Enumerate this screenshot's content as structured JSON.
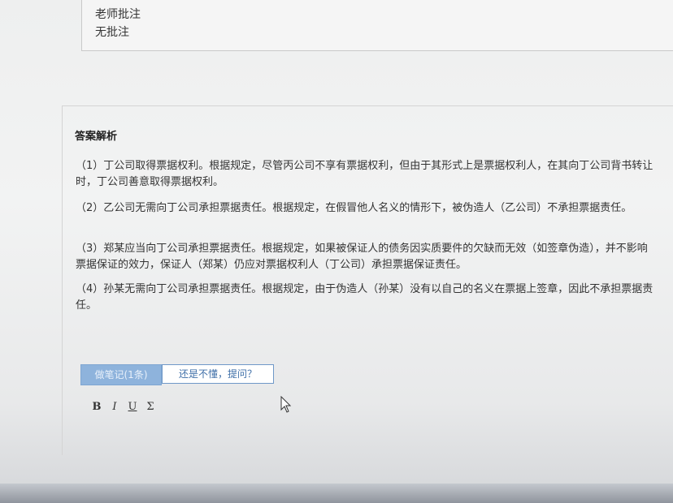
{
  "teacher_comment": {
    "title": "老师批注",
    "body": "无批注"
  },
  "analysis": {
    "title": "答案解析",
    "paragraphs": [
      "（1）丁公司取得票据权利。根据规定，尽管丙公司不享有票据权利，但由于其形式上是票据权利人，在其向丁公司背书转让时，丁公司善意取得票据权利。",
      "（2）乙公司无需向丁公司承担票据责任。根据规定，在假冒他人名义的情形下，被伪造人（乙公司）不承担票据责任。",
      "（3）郑某应当向丁公司承担票据责任。根据规定，如果被保证人的债务因实质要件的欠缺而无效（如签章伪造），并不影响票据保证的效力，保证人（郑某）仍应对票据权利人（丁公司）承担票据保证责任。",
      "（4）孙某无需向丁公司承担票据责任。根据规定，由于伪造人（孙某）没有以自己的名义在票据上签章，因此不承担票据责任。"
    ]
  },
  "actions": {
    "note_label": "做笔记(1条)",
    "ask_label": "还是不懂，提问？"
  },
  "editor_toolbar": {
    "bold": "B",
    "italic": "I",
    "underline": "U",
    "formula": "Σ"
  },
  "icons": {
    "cursor": "mouse-pointer-icon"
  }
}
